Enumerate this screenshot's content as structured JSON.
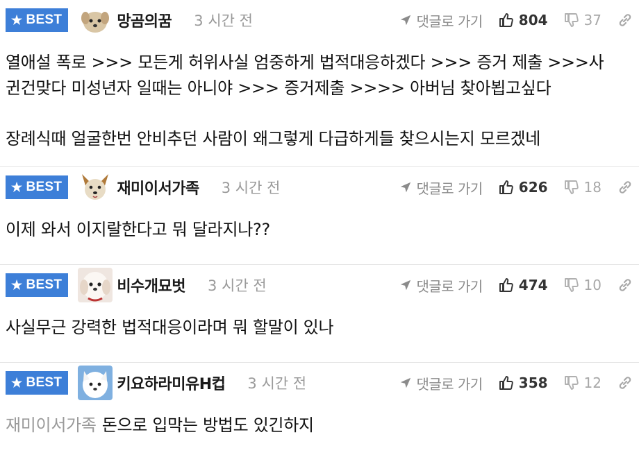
{
  "comments": [
    {
      "badge": "BEST",
      "nickname": "망곰의꿈",
      "time": "3 시간 전",
      "reply_label": "댓글로 가기",
      "likes": "804",
      "dislikes": "37",
      "avatar_icon": "puppy-avatar",
      "lines": [
        "열애설 폭로 >>> 모든게 허위사실 엄중하게 법적대응하겠다 >>> 증거 제출 >>>사",
        "귄건맞다 미성년자 일때는 아니야 >>> 증거제출 >>>> 아버님 찾아뵙고싶다",
        "장례식때 얼굴한번 안비추던 사람이 왜그렇게 다급하게들 찾으시는지 모르겠네"
      ]
    },
    {
      "badge": "BEST",
      "nickname": "재미이서가족",
      "time": "3 시간 전",
      "reply_label": "댓글로 가기",
      "likes": "626",
      "dislikes": "18",
      "avatar_icon": "dog-avatar",
      "text": "이제 와서 이지랄한다고 뭐 달라지나??"
    },
    {
      "badge": "BEST",
      "nickname": "비수개묘벗",
      "time": "3 시간 전",
      "reply_label": "댓글로 가기",
      "likes": "474",
      "dislikes": "10",
      "avatar_icon": "white-dog-avatar",
      "text": "사실무근 강력한 법적대응이라며 뭐 할말이 있나"
    },
    {
      "badge": "BEST",
      "nickname": "키요하라미유H컵",
      "time": "3 시간 전",
      "reply_label": "댓글로 가기",
      "likes": "358",
      "dislikes": "12",
      "avatar_icon": "snow-dog-avatar",
      "mention": "재미이서가족",
      "text": "돈으로 입막는 방법도 있긴하지"
    }
  ],
  "colors": {
    "badge_bg": "#3d7fd8",
    "muted": "#9a9a9a"
  }
}
